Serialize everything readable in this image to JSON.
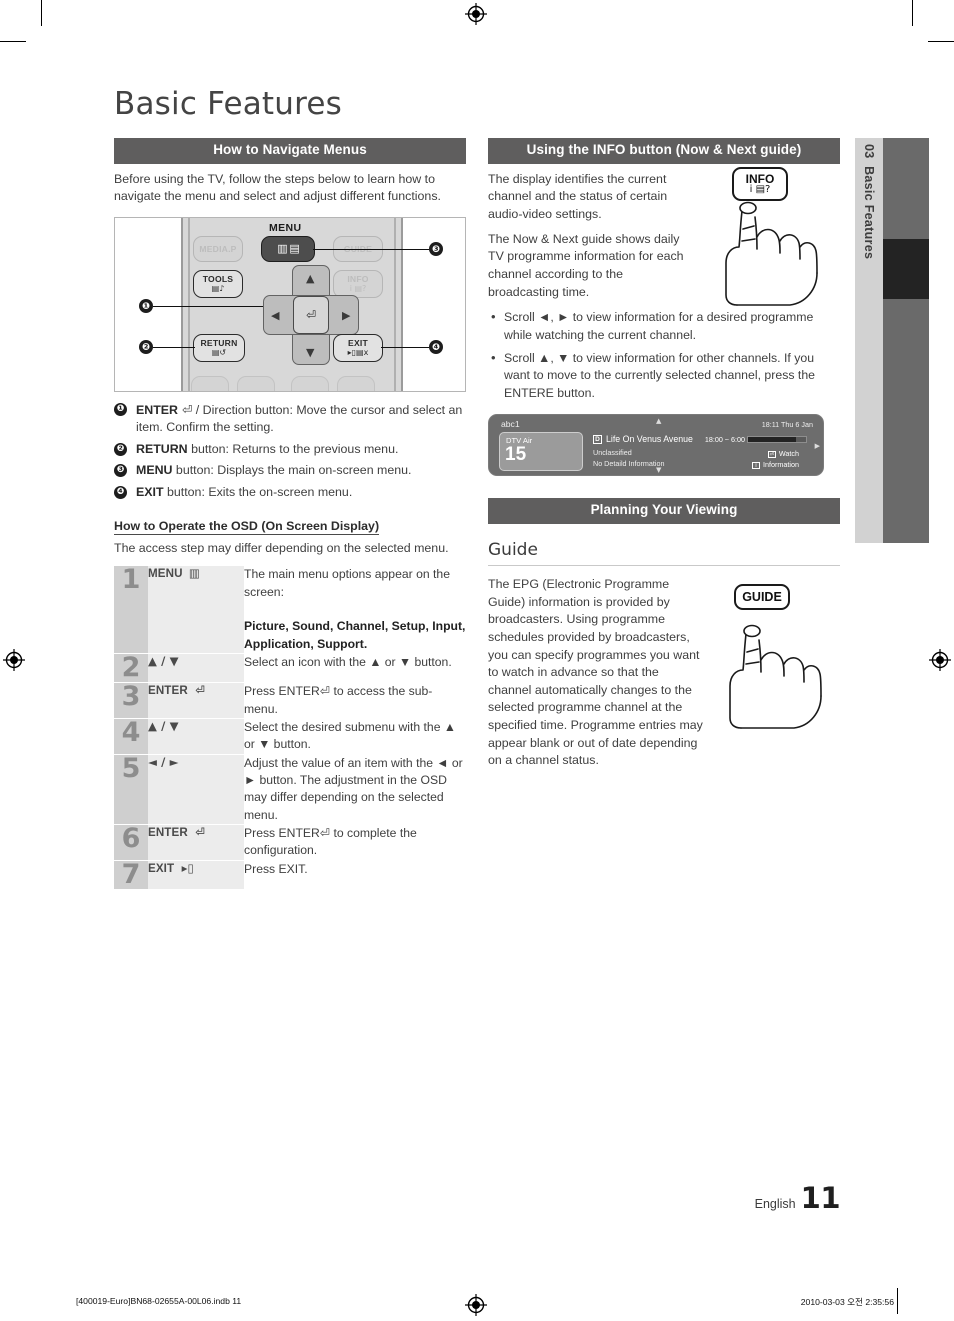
{
  "page": {
    "title": "Basic Features",
    "language": "English",
    "number": "11",
    "side_tab_chapter": "03",
    "side_tab_title": "Basic Features"
  },
  "left": {
    "section_header": "How to Navigate Menus",
    "intro": "Before using the TV, follow the steps below to learn how to navigate the menu and select and adjust different functions.",
    "remote": {
      "menu_label": "MENU",
      "buttons": {
        "media_p": "MEDIA.P",
        "menu": "MENU",
        "guide": "GUIDE",
        "tools": "TOOLS",
        "info": "INFO",
        "return": "RETURN",
        "exit": "EXIT"
      },
      "callouts": [
        "1",
        "2",
        "3",
        "4"
      ]
    },
    "legend": [
      {
        "n": "1",
        "term": "ENTER",
        "text": " / Direction button: Move the cursor and select an item. Confirm the setting."
      },
      {
        "n": "2",
        "term": "RETURN",
        "text": " button: Returns to the previous menu."
      },
      {
        "n": "3",
        "term": "MENU",
        "text": " button: Displays the main on-screen menu."
      },
      {
        "n": "4",
        "term": "EXIT",
        "text": " button: Exits the on-screen menu."
      }
    ],
    "osd_heading": "How to Operate the OSD (On Screen Display)",
    "osd_note": "The access step may differ depending on the selected menu.",
    "steps": [
      {
        "n": "1",
        "key": "MENU",
        "key_icon": "menu-icon",
        "desc_lead": "The main menu options appear on the screen:",
        "desc_bold": "Picture, Sound, Channel, Setup, Input, Application, Support."
      },
      {
        "n": "2",
        "key": "▲ / ▼",
        "key_icon": "",
        "desc_lead": "Select an icon with the ▲ or ▼ button.",
        "desc_bold": ""
      },
      {
        "n": "3",
        "key": "ENTER",
        "key_icon": "enter-icon",
        "desc_lead": "Press ENTER⏎ to access the sub-menu.",
        "desc_bold": ""
      },
      {
        "n": "4",
        "key": "▲ / ▼",
        "key_icon": "",
        "desc_lead": "Select the desired submenu with the ▲ or ▼ button.",
        "desc_bold": ""
      },
      {
        "n": "5",
        "key": "◄ / ►",
        "key_icon": "",
        "desc_lead": "Adjust the value of an item with the ◄ or ► button. The adjustment in the OSD may differ depending on the selected menu.",
        "desc_bold": ""
      },
      {
        "n": "6",
        "key": "ENTER",
        "key_icon": "enter-icon",
        "desc_lead": "Press ENTER⏎ to complete the configuration.",
        "desc_bold": ""
      },
      {
        "n": "7",
        "key": "EXIT",
        "key_icon": "exit-icon",
        "desc_lead": "Press EXIT.",
        "desc_bold": ""
      }
    ]
  },
  "right": {
    "section_header": "Using the INFO button (Now & Next guide)",
    "para1": "The display identifies the current channel and the status of certain audio-video settings.",
    "para2": "The Now & Next guide shows daily TV programme information for each channel according to the broadcasting time.",
    "bullets": [
      "Scroll ◄, ► to view information for a desired programme while watching the current channel.",
      "Scroll ▲, ▼ to view information for other channels. If you want to move to the currently selected channel, press the ENTERE button."
    ],
    "info_button_label": "INFO",
    "osd_mock": {
      "channel_name": "abc1",
      "clock": "18:11 Thu 6 Jan",
      "source": "DTV Air",
      "channel_number": "15",
      "programme_tag": "D",
      "programme": "Life On Venus Avenue",
      "rating": "Unclassified",
      "detail": "No Detaild Information",
      "timespan": "18:00 ~ 6:00",
      "progress_percent": 82,
      "action_watch": "Watch",
      "action_information": "Information"
    },
    "planning_header": "Planning Your Viewing",
    "guide_heading": "Guide",
    "guide_para": "The EPG (Electronic Programme Guide) information is provided by broadcasters. Using programme schedules provided by broadcasters, you can specify programmes you want to watch in advance so that the channel automatically changes to the selected programme channel at the specified time. Programme entries may appear blank or out of date depending on a channel status.",
    "guide_button_label": "GUIDE"
  },
  "footer": {
    "left": "[400019-Euro]BN68-02655A-00L06.indb   11",
    "right": "2010-03-03   오전 2:35:56"
  }
}
